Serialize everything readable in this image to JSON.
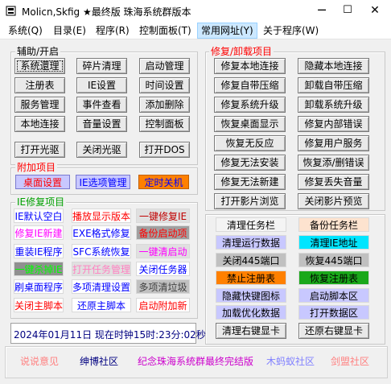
{
  "window": {
    "title": "Molicn,Skfig ★最终版 珠海系统群版本",
    "minimize": "─",
    "maximize": "☐",
    "close": "✕"
  },
  "menu": [
    "系统(Q)",
    "目录(E)",
    "程序(R)",
    "控制面板(T)",
    "常用网址(Y)",
    "关于程序(W)"
  ],
  "groups": {
    "assist": "辅助/开启",
    "repair": "修复/卸载项目",
    "extra": "附加项目",
    "ie": "IE修复项目"
  },
  "assist_buttons": [
    [
      "系统還理",
      "碎片清理",
      "启动管理"
    ],
    [
      "注册表",
      "IE设置",
      "时间设置"
    ],
    [
      "服务管理",
      "事件查看",
      "添加删除"
    ],
    [
      "本地连接",
      "音量设置",
      "控制面板"
    ],
    [
      "打开光驱",
      "关闭光驱",
      "打开DOS"
    ]
  ],
  "extra_buttons": [
    "桌面设置",
    "IE选项管理",
    "定时关机"
  ],
  "ie_items": [
    [
      "IE默认空白",
      "播放显示版本",
      "一键修复IE"
    ],
    [
      "修复IE新建",
      "EXE格式修复",
      "备份启动项"
    ],
    [
      "重装IE程序",
      "SFC系统恢复",
      "一键清启动"
    ],
    [
      "一键杀掉IE",
      "打开任务管理",
      "关闭任务器"
    ],
    [
      "刷桌面程序",
      "多项清理设置",
      "多项清垃圾"
    ],
    [
      "关闭主脚本",
      "还原主脚本",
      "启动附加新"
    ]
  ],
  "repair_buttons": [
    [
      "修复本地连接",
      "隐藏本地连接"
    ],
    [
      "修复自带压缩",
      "卸载自带压缩"
    ],
    [
      "修复系统升级",
      "卸载系统升级"
    ],
    [
      "恢复桌面显示",
      "修复内部错误"
    ],
    [
      "恢复无反应",
      "修复用户服务"
    ],
    [
      "修复无法安装",
      "恢复添/删错误"
    ],
    [
      "修复无法新建",
      "修复丢失音量"
    ],
    [
      "打开影片浏览",
      "关闭影片预览"
    ]
  ],
  "task_items": [
    [
      "清理任务栏",
      "备份任务栏"
    ],
    [
      "清理运行数据",
      "清理IE地址"
    ],
    [
      "关闭445端口",
      "恢复445端口"
    ],
    [
      "禁止注册表",
      "恢复注册表"
    ],
    [
      "隐藏快键图标",
      "启动脚本区"
    ],
    [
      "加载优化数据",
      "打开数据区"
    ],
    [
      "清理右键显卡",
      "还原右键显卡"
    ]
  ],
  "status": "2024年01月11日 现在时钟15时:23分:02秒",
  "footer": [
    "说说意见",
    "绅博社区",
    "纪念珠海系统群最终完结版",
    "木蚂蚁社区",
    "剑盟社区"
  ],
  "colors": {
    "red": "#ff0000",
    "blue": "#0000ff",
    "magenta": "#cc00cc",
    "green_bg": "#1aa81a",
    "orange_bg": "#ff8000",
    "cyan_bg": "#00e5ff"
  }
}
